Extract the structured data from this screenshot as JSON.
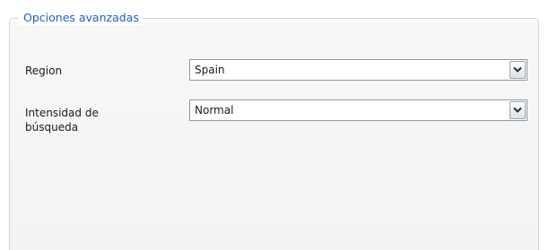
{
  "groupbox": {
    "title": "Opciones avanzadas"
  },
  "fields": {
    "region": {
      "label": "Region",
      "value": "Spain"
    },
    "intensidad": {
      "label": "Intensidad de\nbúsqueda",
      "value": "Normal"
    }
  },
  "colors": {
    "legend_text": "#1f5fbf",
    "border": "#cfd3d8"
  },
  "icons": {
    "dropdown": "chevron-down-icon"
  }
}
